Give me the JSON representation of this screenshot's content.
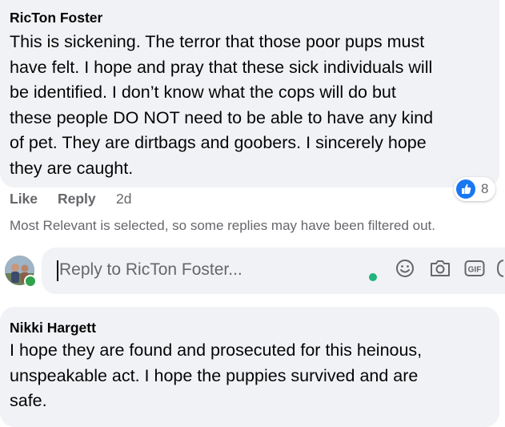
{
  "comment1": {
    "author": "RicTon Foster",
    "lines": [
      "This is sickening. The terror that those poor pups must",
      "have felt. I hope and pray that these sick individuals will",
      "be identified. I don’t know what the cops will do but",
      "these people DO NOT need to be able to have any kind",
      "of pet. They are dirtbags and goobers. I sincerely hope",
      "they are caught."
    ],
    "actions": {
      "like": "Like",
      "reply": "Reply",
      "time": "2d"
    },
    "reaction": {
      "icon": "like-icon",
      "count": "8",
      "color": "#1877f2"
    }
  },
  "notice": "Most Relevant is selected, so some replies may have been filtered out.",
  "reply_box": {
    "placeholder": "Reply to RicTon Foster...",
    "value": "",
    "tools": [
      "emoji-icon",
      "camera-icon",
      "gif-icon",
      "sticker-icon"
    ]
  },
  "comment2": {
    "author": "Nikki Hargett",
    "lines": [
      "I hope they are found and prosecuted for this heinous,",
      "unspeakable act. I hope the puppies survived and are",
      "safe."
    ]
  },
  "colors": {
    "bubble": "#f0f2f5",
    "secondary_text": "#65676b",
    "online": "#31a24c",
    "accent": "#1877f2"
  }
}
